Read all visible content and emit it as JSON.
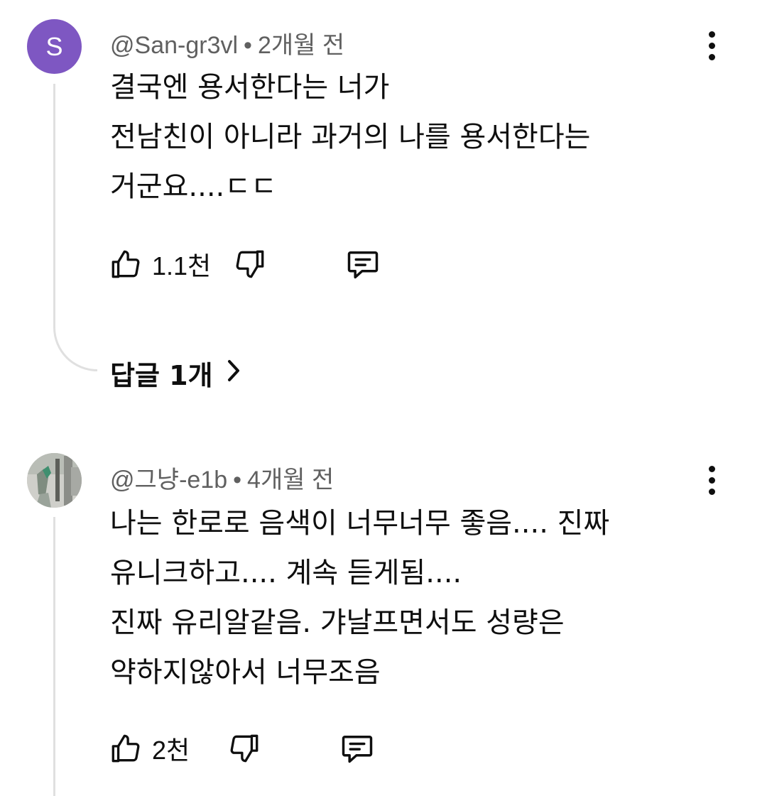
{
  "comments": [
    {
      "avatar_letter": "S",
      "author": "@San-gr3vl",
      "separator": "•",
      "time": "2개월 전",
      "lines": [
        "결국엔 용서한다는 너가",
        "전남친이 아니라 과거의 나를 용서한다는",
        "거군요....ㄷㄷ"
      ],
      "likes": "1.1천",
      "replies_label": "답글 1개"
    },
    {
      "author": "@그냥-e1b",
      "separator": "•",
      "time": "4개월 전",
      "lines": [
        "나는 한로로 음색이 너무너무 좋음.... 진짜",
        "유니크하고.... 계속 듣게됨....",
        "진짜 유리알같음. 갸날프면서도 성량은",
        "약하지않아서 너무조음"
      ],
      "likes": "2천"
    }
  ],
  "icons": {
    "like": "thumbs-up-icon",
    "dislike": "thumbs-down-icon",
    "reply": "comment-icon",
    "more": "more-vertical-icon",
    "chevron": "chevron-right-icon"
  },
  "colors": {
    "avatar_bg": "#7e57c2",
    "meta_text": "#606060",
    "text": "#0f0f0f",
    "thread_line": "#e0e0e0"
  }
}
